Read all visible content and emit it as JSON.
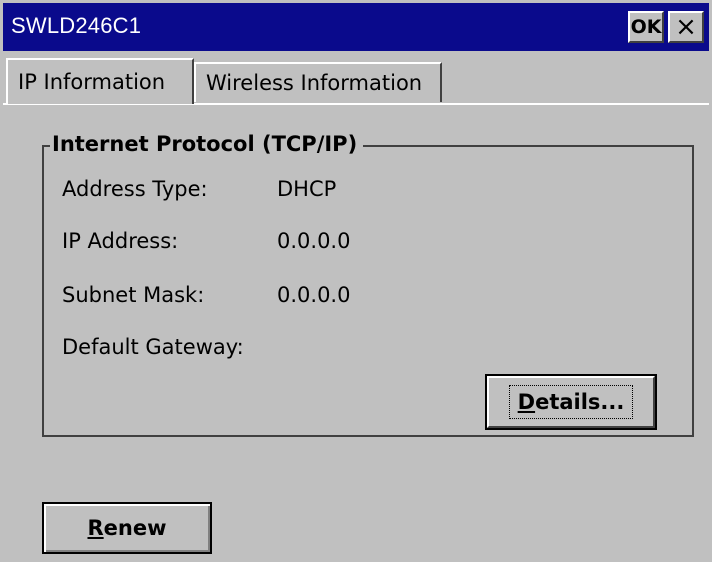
{
  "window": {
    "title": "SWLD246C1",
    "ok_label": "OK",
    "close_label": "×"
  },
  "tabs": [
    {
      "label": "IP Information",
      "selected": true
    },
    {
      "label": "Wireless Information",
      "selected": false
    }
  ],
  "group": {
    "label": "Internet Protocol (TCP/IP)",
    "rows": [
      {
        "label": "Address Type:",
        "value": "DHCP"
      },
      {
        "label": "IP Address:",
        "value": "0.0.0.0"
      },
      {
        "label": "Subnet Mask:",
        "value": "0.0.0.0"
      },
      {
        "label": "Default Gateway:",
        "value": ""
      }
    ],
    "details_button": {
      "access_key": "D",
      "rest": "etails..."
    }
  },
  "renew_button": {
    "access_key": "R",
    "rest": "enew"
  },
  "colors": {
    "titlebar": "#0a0a8c",
    "face": "#c0c0c0"
  }
}
